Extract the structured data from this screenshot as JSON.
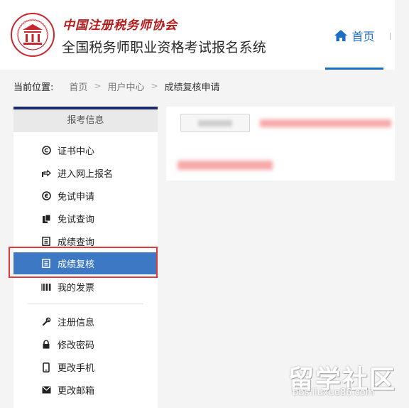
{
  "header": {
    "org_name": "中国注册税务师协会",
    "system_title": "全国税务师职业资格考试报名系统",
    "nav_home": "首页"
  },
  "breadcrumb": {
    "label": "当前位置:",
    "home": "首页",
    "user_center": "用户中心",
    "current": "成绩复核申请",
    "separator": ">"
  },
  "sidebar": {
    "header": "报考信息",
    "items": [
      {
        "label": "证书中心",
        "icon": "copyright-icon"
      },
      {
        "label": "进入网上报名",
        "icon": "hand-pointer-icon"
      },
      {
        "label": "免试申请",
        "icon": "minus-circle-icon"
      },
      {
        "label": "免试查询",
        "icon": "documents-icon"
      },
      {
        "label": "成绩查询",
        "icon": "list-doc-icon"
      },
      {
        "label": "成绩复核",
        "icon": "list-doc-icon",
        "active": true
      },
      {
        "label": "我的发票",
        "icon": "barcode-icon"
      },
      {
        "label": "注册信息",
        "icon": "wrench-icon"
      },
      {
        "label": "修改密码",
        "icon": "lock-icon"
      },
      {
        "label": "更改手机",
        "icon": "phone-icon"
      },
      {
        "label": "更改邮箱",
        "icon": "envelope-icon"
      }
    ]
  },
  "watermark": {
    "main": "留学社区",
    "url": "bbs.liuxue86.com"
  },
  "colors": {
    "accent": "#1a6fc4",
    "active_item": "#3c78c3",
    "brand_red": "#c8262c",
    "highlight": "#e23a3a",
    "sidebar_top": "#1b2a6b"
  }
}
